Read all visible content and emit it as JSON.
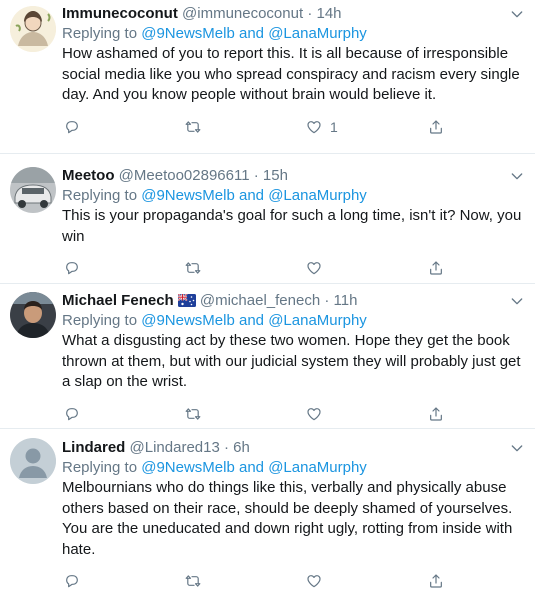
{
  "colors": {
    "accent": "#1b95e0",
    "muted": "#657786",
    "text": "#14171a",
    "divider": "#e6ecf0"
  },
  "tweets": [
    {
      "name": "Immunecoconut",
      "handle": "@immunecoconut",
      "dot": "·",
      "time": "14h",
      "reply_prefix": "Replying to",
      "reply_to_1": "@9NewsMelb",
      "reply_and": "and",
      "reply_to_2": "@LanaMurphy",
      "text": "How ashamed of you to report this. It is all because of irresponsible social media like you who spread conspiracy and racism every single day. And you know people without brain would believe it.",
      "like_count": "1",
      "avatar_icon": "illustrated-avatar"
    },
    {
      "name": "Meetoo",
      "handle": "@Meetoo02896611",
      "dot": "·",
      "time": "15h",
      "reply_prefix": "Replying to",
      "reply_to_1": "@9NewsMelb",
      "reply_and": "and",
      "reply_to_2": "@LanaMurphy",
      "text": "This is your propaganda's goal for such a long time, isn't it? Now, you win",
      "like_count": "",
      "avatar_icon": "car-photo-avatar"
    },
    {
      "name": "Michael Fenech",
      "flag_icon": "australia-flag-icon",
      "handle": "@michael_fenech",
      "dot": "·",
      "time": "11h",
      "reply_prefix": "Replying to",
      "reply_to_1": "@9NewsMelb",
      "reply_and": "and",
      "reply_to_2": "@LanaMurphy",
      "text": "What a disgusting act by these two women. Hope they get the book thrown at them, but with our judicial system they will probably just get a slap on the wrist.",
      "like_count": "",
      "avatar_icon": "person-photo-avatar"
    },
    {
      "name": "Lindared",
      "handle": "@Lindared13",
      "dot": "·",
      "time": "6h",
      "reply_prefix": "Replying to",
      "reply_to_1": "@9NewsMelb",
      "reply_and": "and",
      "reply_to_2": "@LanaMurphy",
      "text": "Melbournians who do things like this, verbally and physically abuse others based on their race, should be deeply shamed of yourselves. You are the uneducated and down right ugly, rotting from inside with hate.",
      "like_count": "",
      "avatar_icon": "default-profile-avatar"
    }
  ],
  "icons": [
    "reply-icon",
    "retweet-icon",
    "like-icon",
    "share-icon",
    "chevron-down-icon"
  ]
}
